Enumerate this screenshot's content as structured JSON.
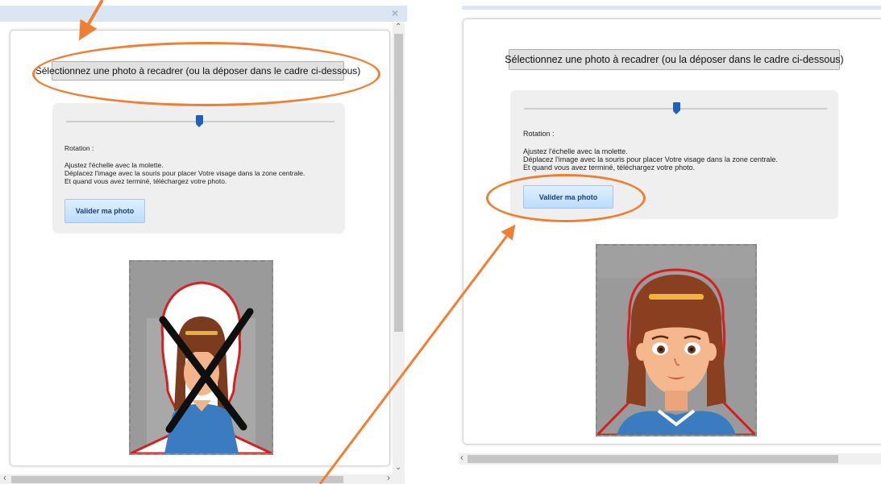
{
  "left_panel": {
    "close_glyph": "×",
    "select_button": "Sélectionnez une photo à recadrer (ou la déposer dans le cadre ci-dessous)",
    "rotation_label": "Rotation :",
    "instructions": [
      "Ajustez l'échelle avec la molette.",
      "Déplacez l'image avec la souris pour placer Votre visage dans la zone centrale.",
      "Et quand vous avez terminé, téléchargez votre photo."
    ],
    "validate_button": "Valider ma photo",
    "scroll_up": "⌃",
    "scroll_down": "⌄",
    "scroll_left": "‹",
    "scroll_right": "›"
  },
  "right_panel": {
    "select_button": "Sélectionnez une photo à recadrer (ou la déposer dans le cadre ci-dessous)",
    "rotation_label": "Rotation :",
    "instructions": [
      "Ajustez l'échelle avec la molette.",
      "Déplacez l'image avec la souris pour placer Votre visage dans la zone centrale.",
      "Et quand vous avez terminé, téléchargez votre photo."
    ],
    "validate_button": "Valider ma photo",
    "scroll_left": "‹"
  },
  "colors": {
    "annotation_orange": "#ee7f33",
    "slider_handle": "#1f5fbf",
    "face_outline": "#d42020"
  },
  "icons": [
    "close-icon",
    "arrow-annotation-icon",
    "ellipse-annotation-icon",
    "cross-mark-icon",
    "face-outline-icon"
  ]
}
